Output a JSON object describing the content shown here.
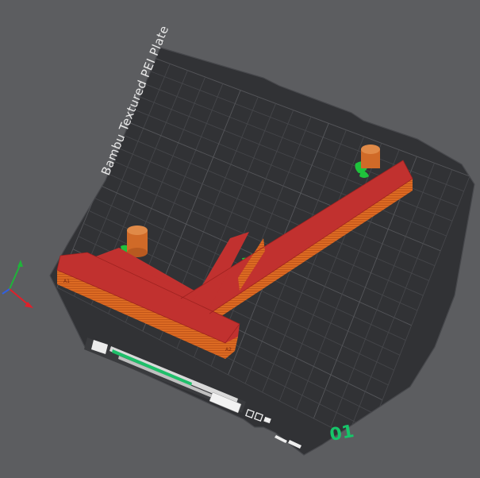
{
  "viewport": {
    "background": "#5c5d60",
    "plate_color": "#313235",
    "grid_color": "#4a4b4f",
    "grid_major_color": "#55565a",
    "model_top_color": "#c1312f",
    "model_side_color": "#dc6a22",
    "support_color": "#1fc23c",
    "accent_color": "#16c66a"
  },
  "plate": {
    "name_label": "Bambu Textured PEI Plate",
    "plate_number": "01"
  },
  "axes": {
    "x_color": "#e0202a",
    "y_color": "#1fb33a"
  },
  "toolbar_icons": [
    {
      "name": "arrange-icon"
    },
    {
      "name": "orient-icon"
    },
    {
      "name": "lock-icon"
    },
    {
      "name": "settings-icon"
    }
  ]
}
